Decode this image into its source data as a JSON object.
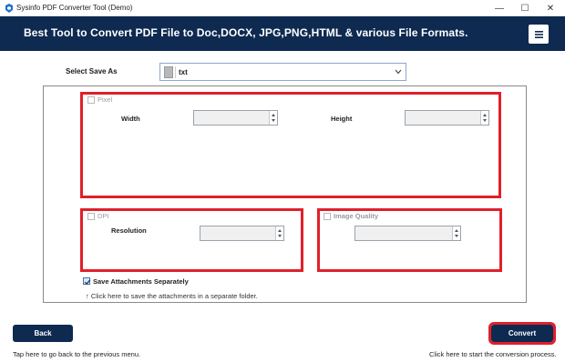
{
  "window": {
    "title": "Sysinfo PDF Converter Tool (Demo)",
    "minimize_glyph": "—",
    "maximize_glyph": "☐",
    "close_glyph": "✕"
  },
  "header": {
    "title": "Best Tool to Convert PDF File to Doc,DOCX, JPG,PNG,HTML & various File Formats.",
    "menu_icon": "hamburger-menu-icon"
  },
  "save_as": {
    "label": "Select Save As",
    "selected": "txt"
  },
  "pixel": {
    "checkbox_label": "Pixel",
    "checked": false,
    "width_label": "Width",
    "height_label": "Height",
    "width_value": "",
    "height_value": ""
  },
  "dpi": {
    "checkbox_label": "DPI",
    "checked": false,
    "resolution_label": "Resolution",
    "resolution_value": ""
  },
  "image_quality": {
    "checkbox_label": "Image Quality",
    "checked": false,
    "value": ""
  },
  "attachments": {
    "label": "Save Attachments Separately",
    "checked": true,
    "hint": "↑ Click here to save the attachments in a separate folder."
  },
  "footer": {
    "back_label": "Back",
    "back_hint": "Tap here to go back to the previous menu.",
    "convert_label": "Convert",
    "convert_hint": "Click here to start the conversion process."
  },
  "colors": {
    "header_bg": "#0e2a51",
    "highlight": "#e0202a",
    "button_bg": "#0e2a51"
  }
}
